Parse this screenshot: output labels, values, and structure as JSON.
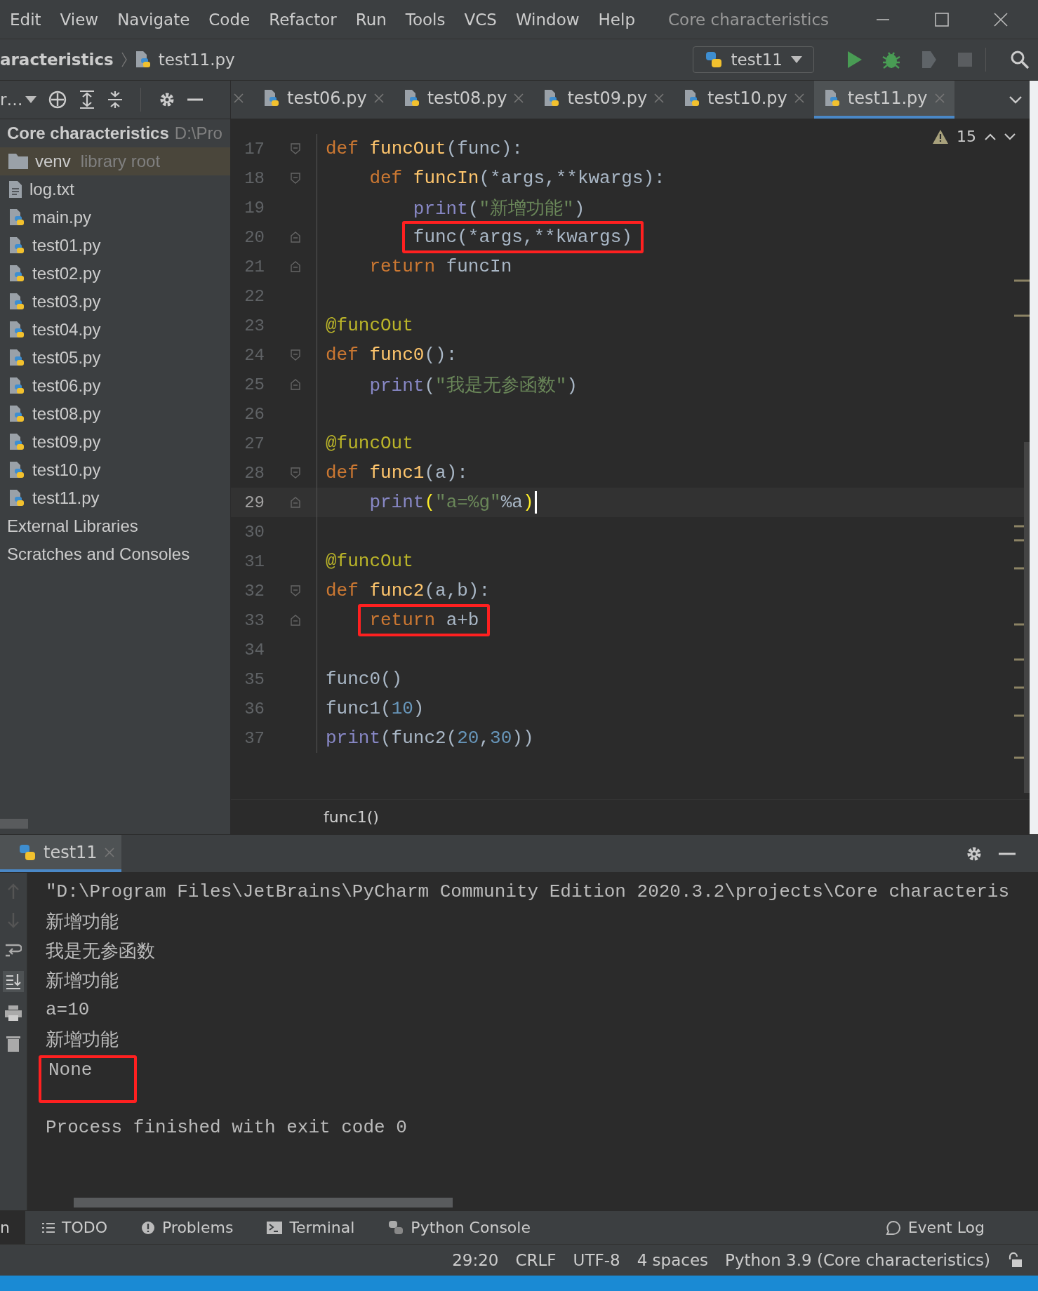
{
  "menu_bar": {
    "items": [
      "Edit",
      "View",
      "Navigate",
      "Code",
      "Refactor",
      "Run",
      "Tools",
      "VCS",
      "Window",
      "Help"
    ],
    "title": "Core characteristics"
  },
  "nav_bar": {
    "breadcrumbs": [
      "aracteristics",
      "test11.py"
    ],
    "run_config": "test11"
  },
  "project_toolbar": {
    "view_label": "r…"
  },
  "tabs": [
    {
      "selected": false
    },
    {
      "label": "test06.py",
      "selected": false
    },
    {
      "label": "test08.py",
      "selected": false
    },
    {
      "label": "test09.py",
      "selected": false
    },
    {
      "label": "test10.py",
      "selected": false
    },
    {
      "label": "test11.py",
      "selected": true
    }
  ],
  "project_tree": {
    "root": {
      "name": "Core characteristics",
      "path": "D:\\Pro"
    },
    "items": [
      {
        "kind": "folder",
        "name": "venv",
        "note": "library root",
        "selected": true
      },
      {
        "kind": "text",
        "name": "log.txt",
        "selected": false
      },
      {
        "kind": "python",
        "name": "main.py",
        "selected": false
      },
      {
        "kind": "python",
        "name": "test01.py",
        "selected": false
      },
      {
        "kind": "python",
        "name": "test02.py",
        "selected": false
      },
      {
        "kind": "python",
        "name": "test03.py",
        "selected": false
      },
      {
        "kind": "python",
        "name": "test04.py",
        "selected": false
      },
      {
        "kind": "python",
        "name": "test05.py",
        "selected": false
      },
      {
        "kind": "python",
        "name": "test06.py",
        "selected": false
      },
      {
        "kind": "python",
        "name": "test08.py",
        "selected": false
      },
      {
        "kind": "python",
        "name": "test09.py",
        "selected": false
      },
      {
        "kind": "python",
        "name": "test10.py",
        "selected": false
      },
      {
        "kind": "python",
        "name": "test11.py",
        "selected": false
      }
    ],
    "groups": [
      "External Libraries",
      "Scratches and Consoles"
    ]
  },
  "editor": {
    "warnings": "15",
    "lines": [
      {
        "number": "17",
        "tokens": [
          {
            "kind": "kw",
            "text": "def "
          },
          {
            "kind": "fn",
            "text": "funcOut"
          },
          {
            "kind": "plain",
            "text": "(func):"
          }
        ],
        "children": [
          {
            "number": "18",
            "tokens": [
              {
                "kind": "kw",
                "text": "def "
              },
              {
                "kind": "fn",
                "text": "funcIn"
              },
              {
                "kind": "plain",
                "text": "(*args,**kwargs):"
              }
            ],
            "children": [
              {
                "number": "19",
                "tokens": [
                  {
                    "kind": "builtin",
                    "text": "print"
                  },
                  {
                    "kind": "plain",
                    "text": "("
                  },
                  {
                    "kind": "str",
                    "text": "\"新增功能\""
                  },
                  {
                    "kind": "plain",
                    "text": ")"
                  }
                ]
              },
              {
                "number": "20",
                "boxed": true,
                "tokens": [
                  {
                    "kind": "plain",
                    "text": "func(*args,**kwargs)"
                  }
                ]
              }
            ]
          },
          {
            "number": "21",
            "tokens": [
              {
                "kind": "kw",
                "text": "return "
              },
              {
                "kind": "plain",
                "text": "funcIn"
              }
            ]
          }
        ]
      },
      {
        "number": "22"
      },
      {
        "number": "23",
        "tokens": [
          {
            "kind": "deco",
            "text": "@funcOut"
          }
        ]
      },
      {
        "number": "24",
        "tokens": [
          {
            "kind": "kw",
            "text": "def "
          },
          {
            "kind": "fn",
            "text": "func0"
          },
          {
            "kind": "plain",
            "text": "():"
          }
        ],
        "children": [
          {
            "number": "25",
            "tokens": [
              {
                "kind": "builtin",
                "text": "print"
              },
              {
                "kind": "plain",
                "text": "("
              },
              {
                "kind": "str",
                "text": "\"我是无参函数\""
              },
              {
                "kind": "plain",
                "text": ")"
              }
            ]
          }
        ]
      },
      {
        "number": "26"
      },
      {
        "number": "27",
        "tokens": [
          {
            "kind": "deco",
            "text": "@funcOut"
          }
        ]
      },
      {
        "number": "28",
        "tokens": [
          {
            "kind": "kw",
            "text": "def "
          },
          {
            "kind": "fn",
            "text": "func1"
          },
          {
            "kind": "plain",
            "text": "(a):"
          }
        ],
        "children": [
          {
            "number": "29",
            "current": true,
            "tokens": [
              {
                "kind": "builtin",
                "text": "print"
              },
              {
                "kind": "brace",
                "text": "("
              },
              {
                "kind": "str",
                "text": "\"a=%g\""
              },
              {
                "kind": "plain",
                "text": "%a"
              },
              {
                "kind": "brace",
                "text": ")"
              }
            ]
          }
        ]
      },
      {
        "number": "30"
      },
      {
        "number": "31",
        "tokens": [
          {
            "kind": "deco",
            "text": "@funcOut"
          }
        ]
      },
      {
        "number": "32",
        "tokens": [
          {
            "kind": "kw",
            "text": "def "
          },
          {
            "kind": "fn",
            "text": "func2"
          },
          {
            "kind": "plain",
            "text": "(a,b):"
          }
        ],
        "children": [
          {
            "number": "33",
            "boxed": true,
            "tokens": [
              {
                "kind": "kw",
                "text": "return "
              },
              {
                "kind": "plain",
                "text": "a+b"
              }
            ]
          }
        ]
      },
      {
        "number": "34"
      },
      {
        "number": "35",
        "tokens": [
          {
            "kind": "plain",
            "text": "func0()"
          }
        ]
      },
      {
        "number": "36",
        "tokens": [
          {
            "kind": "plain",
            "text": "func1("
          },
          {
            "kind": "num",
            "text": "10"
          },
          {
            "kind": "plain",
            "text": ")"
          }
        ]
      },
      {
        "number": "37",
        "tokens": [
          {
            "kind": "builtin",
            "text": "print"
          },
          {
            "kind": "plain",
            "text": "(func2("
          },
          {
            "kind": "num",
            "text": "20"
          },
          {
            "kind": "plain",
            "text": ","
          },
          {
            "kind": "num",
            "text": "30"
          },
          {
            "kind": "plain",
            "text": "))"
          }
        ]
      }
    ],
    "breadcrumb": "func1()"
  },
  "run_panel": {
    "tab": "test11",
    "lines": [
      {
        "text": "\"D:\\Program Files\\JetBrains\\PyCharm Community Edition 2020.3.2\\projects\\Core characteris",
        "boxed": false
      },
      {
        "text": "新增功能",
        "boxed": false
      },
      {
        "text": "我是无参函数",
        "boxed": false
      },
      {
        "text": "新增功能",
        "boxed": false
      },
      {
        "text": "a=10",
        "boxed": false
      },
      {
        "text": "新增功能",
        "boxed": false
      },
      {
        "text": "None",
        "boxed": true
      },
      {
        "text": "Process finished with exit code 0",
        "boxed": false,
        "kind": "exit"
      }
    ]
  },
  "tool_bar": {
    "items": [
      {
        "label": "n",
        "selected": true
      },
      {
        "label": "TODO",
        "selected": false
      },
      {
        "label": "Problems",
        "selected": false
      },
      {
        "label": "Terminal",
        "selected": false
      },
      {
        "label": "Python Console",
        "selected": false
      }
    ],
    "right": "Event Log"
  },
  "status_bar": [
    "29:20",
    "CRLF",
    "UTF-8",
    "4 spaces",
    "Python 3.9 (Core characteristics)"
  ]
}
